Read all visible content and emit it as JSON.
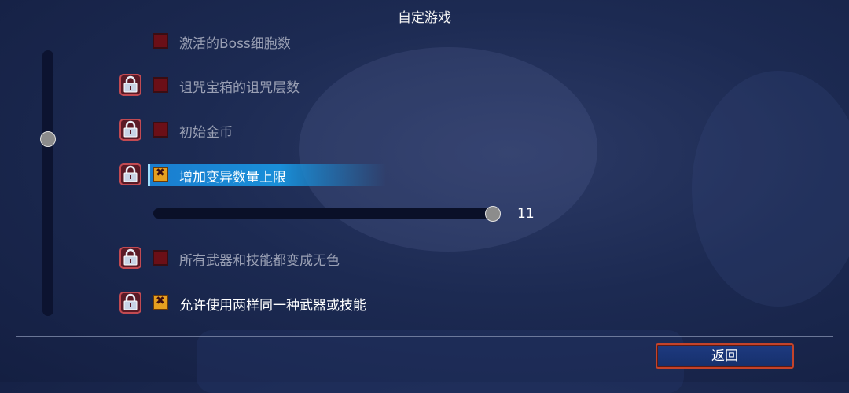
{
  "header": {
    "title": "自定游戏"
  },
  "settings": [
    {
      "label": "激活的Boss细胞数",
      "checked": false,
      "locked": false,
      "style": "dim"
    },
    {
      "label": "诅咒宝箱的诅咒层数",
      "checked": false,
      "locked": true,
      "style": "dim"
    },
    {
      "label": "初始金币",
      "checked": false,
      "locked": true,
      "style": "dim"
    },
    {
      "label": "增加变异数量上限",
      "checked": true,
      "locked": true,
      "style": "bright",
      "selected": true
    },
    {
      "label": "所有武器和技能都变成无色",
      "checked": false,
      "locked": true,
      "style": "dim"
    },
    {
      "label": "允许使用两样同一种武器或技能",
      "checked": true,
      "locked": true,
      "style": "bright"
    }
  ],
  "mutation_slider": {
    "value": "11"
  },
  "footer": {
    "back_label": "返回"
  },
  "colors": {
    "highlight": "#1a8fd8",
    "checkbox_unchecked": "#6b0f17",
    "checkbox_checked": "#e6a020",
    "button_border": "#c4432a"
  },
  "icons": {
    "lock": "lock-icon",
    "checkmark": "x-mark-icon"
  }
}
